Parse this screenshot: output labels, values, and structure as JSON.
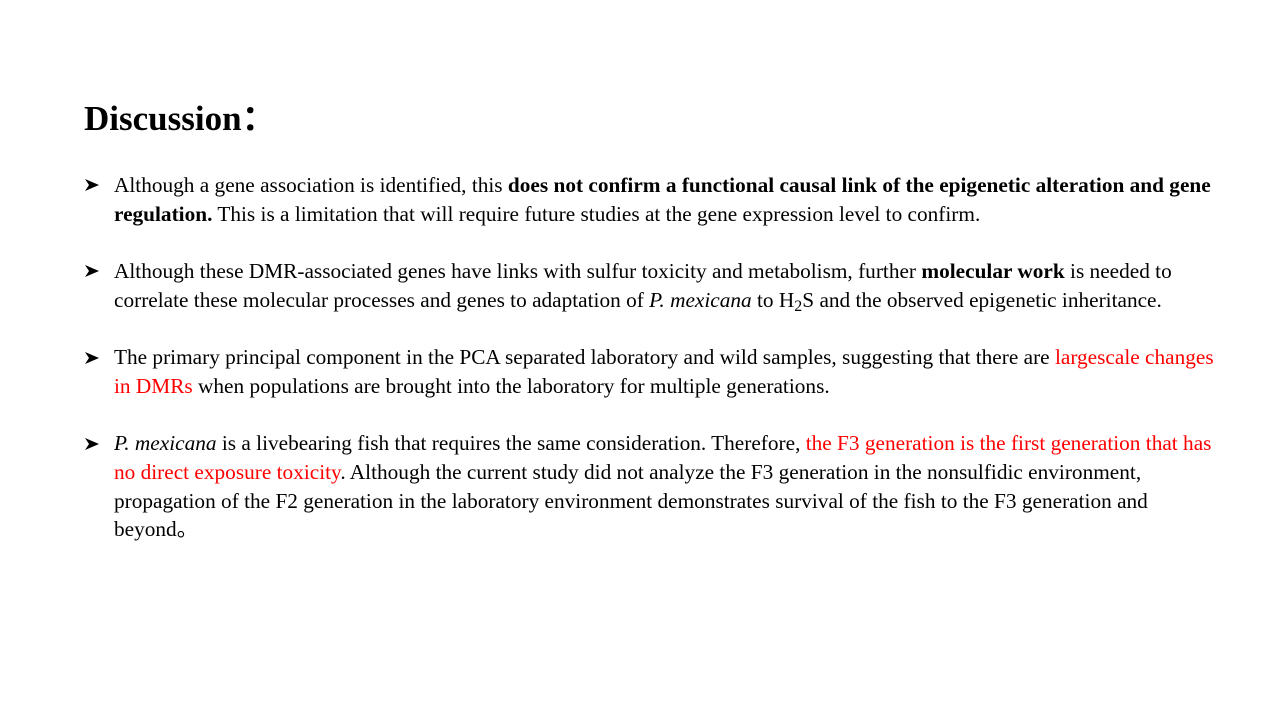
{
  "title": "Discussion：",
  "bullets": [
    {
      "b1_t1": "Although a gene association is identified, this ",
      "b1_t2": "does not confirm a functional causal link of the epigenetic alteration and gene regulation.",
      "b1_t3": " This is a limitation that will require future studies at the gene expression level to confirm."
    },
    {
      "b2_t1": "Although these DMR-associated genes have links with sulfur toxicity and metabolism, further ",
      "b2_t2": "molecular work",
      "b2_t3": " is needed to correlate these molecular processes and genes to adaptation of ",
      "b2_t4": "P. mexicana",
      "b2_t5": " to H",
      "b2_t6": "2",
      "b2_t7": "S and the observed epigenetic inheritance."
    },
    {
      "b3_t1": "The primary principal component in the PCA separated laboratory and wild samples, suggesting that there are ",
      "b3_t2": "largescale changes in DMRs",
      "b3_t3": " when populations are brought into the laboratory for multiple generations."
    },
    {
      "b4_t1": "P. mexicana",
      "b4_t2": " is a livebearing fish that requires the same consideration. Therefore, ",
      "b4_t3": "the F3 generation is the first generation that has no direct exposure toxicity",
      "b4_t4": ". Although the current study did not analyze the F3 generation in the nonsulfidic environment, propagation of the F2 generation in the laboratory environment demonstrates survival of the fish to the F3 generation and beyond。"
    }
  ],
  "icons": {
    "bullet_marker": "arrowhead-bullet-icon"
  },
  "colors": {
    "text": "#000000",
    "highlight": "#ff0000",
    "background": "#ffffff"
  }
}
